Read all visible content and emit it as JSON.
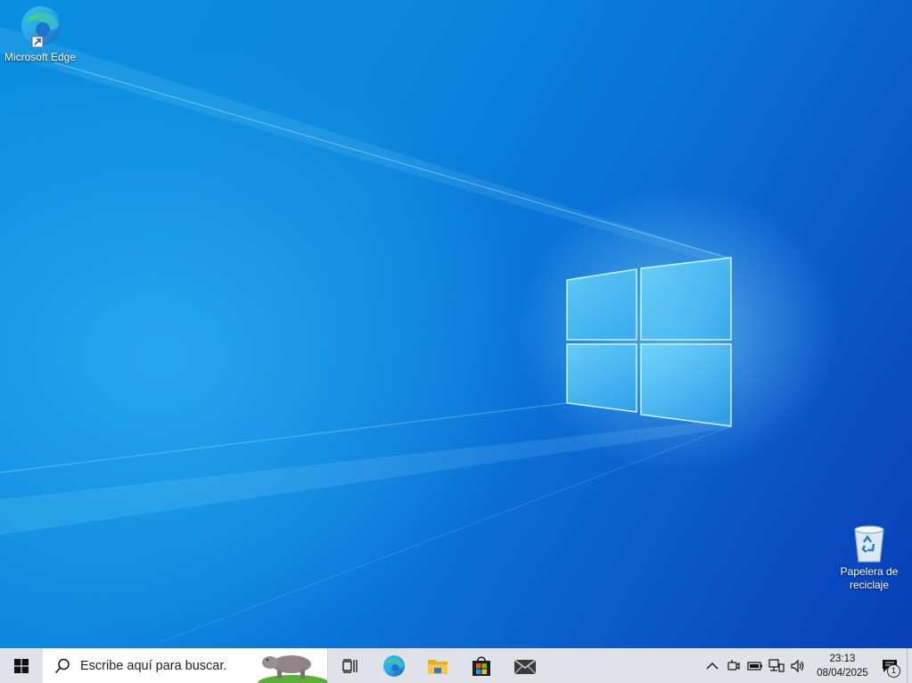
{
  "desktop": {
    "icons": [
      {
        "label": "Microsoft Edge",
        "icon": "edge-icon"
      },
      {
        "label": "Papelera de reciclaje",
        "icon": "recycle-bin-icon"
      }
    ]
  },
  "taskbar": {
    "start_icon": "windows-logo-icon",
    "search": {
      "placeholder": "Escribe aquí para buscar.",
      "icon": "search-icon"
    },
    "pinned": [
      "task-view-icon",
      "edge-icon",
      "file-explorer-icon",
      "store-icon",
      "mail-icon"
    ],
    "tray": {
      "icons": [
        "chevron-up-icon",
        "meet-now-icon",
        "battery-icon",
        "network-icon",
        "volume-icon"
      ],
      "time": "23:13",
      "date": "08/04/2025",
      "notification_count": "1"
    }
  }
}
